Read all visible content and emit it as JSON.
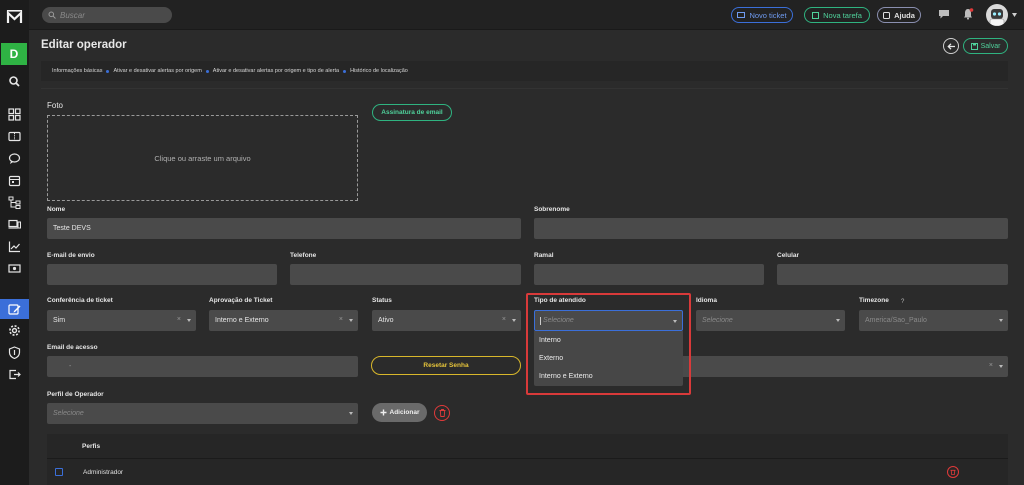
{
  "topbar": {
    "search_placeholder": "Buscar",
    "new_ticket": "Novo ticket",
    "new_task": "Nova tarefa",
    "help": "Ajuda"
  },
  "sidebar": {
    "company_initial": "D",
    "items": [
      "search-icon",
      "dashboard-icon",
      "ticket-icon",
      "chat-icon",
      "calendar-icon",
      "hierarchy-icon",
      "devices-icon",
      "chart-icon",
      "money-icon",
      "operator-edit-icon",
      "gear-icon",
      "shield-icon",
      "logout-icon"
    ]
  },
  "header": {
    "title": "Editar operador",
    "save_label": "Salvar"
  },
  "tabs": [
    "Informações básicas",
    "Ativar e desativar alertas por origem",
    "Ativar e desativar alertas por origem e tipo de alerta",
    "Histórico de localização"
  ],
  "form": {
    "photo_label": "Foto",
    "upload_hint": "Clique ou arraste um arquivo",
    "signature_button": "Assinatura de email",
    "name_label": "Nome",
    "name_value": "Teste DEVS",
    "surname_label": "Sobrenome",
    "surname_value": "",
    "send_email_label": "E-mail de envio",
    "send_email_value": "",
    "phone_label": "Telefone",
    "phone_value": "",
    "extension_label": "Ramal",
    "extension_value": "",
    "mobile_label": "Celular",
    "mobile_value": "",
    "ticket_conference_label": "Conferência de ticket",
    "ticket_conference_value": "Sim",
    "ticket_approval_label": "Aprovação de Ticket",
    "ticket_approval_value": "Interno e Externo",
    "status_label": "Status",
    "status_value": "Ativo",
    "service_type_label": "Tipo de atendido",
    "service_type_placeholder": "Selecione",
    "language_label": "Idioma",
    "language_placeholder": "Selecione",
    "timezone_label": "Timezone",
    "timezone_value": "America/Sao_Paulo",
    "access_email_label": "Email de acesso",
    "access_email_value": "-",
    "reset_password": "Resetar Senha",
    "operator_profile_label": "Perfil de Operador",
    "operator_profile_placeholder": "Selecione",
    "add_button": "Adicionar",
    "clear_symbol": "×"
  },
  "dropdown": {
    "options": [
      "Interno",
      "Externo",
      "Interno e Externo"
    ]
  },
  "profiles_table": {
    "header": "Perfis",
    "rows": [
      {
        "name": "Administrador"
      }
    ]
  },
  "colors": {
    "accent_blue": "#3b6fd9",
    "accent_green": "#2fb380",
    "warning_yellow": "#d9b72b",
    "danger_red": "#e03a3a",
    "sidebar_active": "#3b6fd9"
  }
}
